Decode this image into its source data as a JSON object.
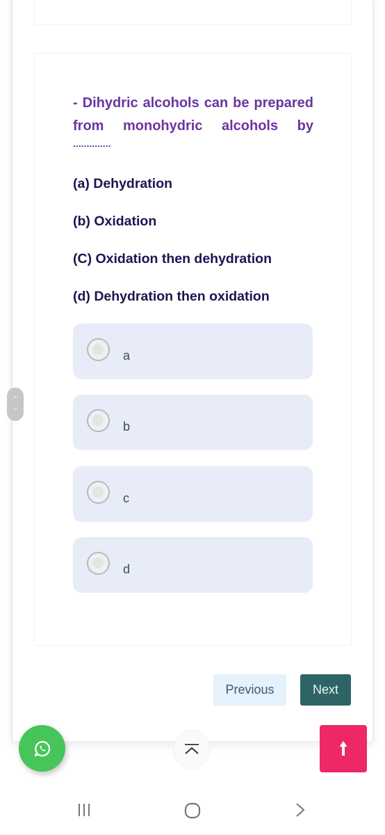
{
  "question": {
    "text": "- Dihydric alcohols can be prepared from monohydric alcohols by",
    "blank": "..............",
    "choices": [
      "(a) Dehydration",
      "(b) Oxidation",
      "(C) Oxidation then dehydration",
      "(d) Dehydration then oxidation"
    ]
  },
  "options": [
    {
      "label": "a",
      "selected": false
    },
    {
      "label": "b",
      "selected": false
    },
    {
      "label": "c",
      "selected": false
    },
    {
      "label": "d",
      "selected": false
    }
  ],
  "navigation": {
    "previous_label": "Previous",
    "next_label": "Next"
  },
  "floating": {
    "whatsapp_icon": "whatsapp-icon",
    "collapse_icon": "chevron-up-bar-icon",
    "scroll_top_icon": "arrow-up-icon",
    "side_scroll_icon": "scroll-up-down-icon"
  },
  "system_nav": {
    "recents_icon": "recents-icon",
    "home_icon": "home-icon",
    "back_icon": "back-icon"
  },
  "colors": {
    "question": "#6a35a0",
    "choices": "#1c1550",
    "option_bg": "#e8ecf9",
    "next_bg": "#2f6466",
    "previous_bg": "#e5f1fc",
    "whatsapp": "#48c55a",
    "scroll_top": "#ee2866"
  }
}
